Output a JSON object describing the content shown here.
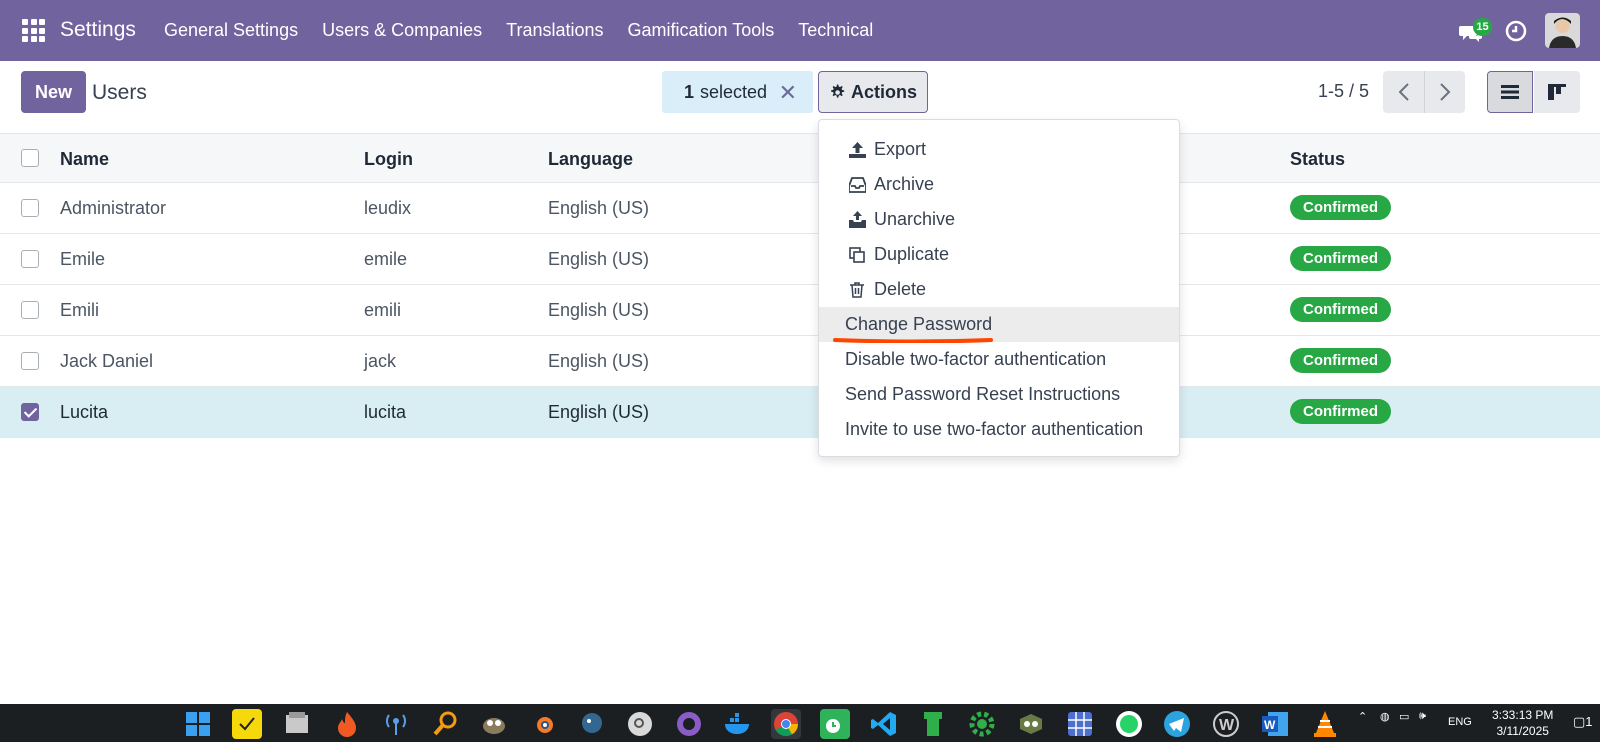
{
  "navbar": {
    "app_name": "Settings",
    "menu": [
      "General Settings",
      "Users & Companies",
      "Translations",
      "Gamification Tools",
      "Technical"
    ],
    "chat_count": "15",
    "bg_color": "#71639e"
  },
  "control_panel": {
    "new_label": "New",
    "breadcrumb": "Users",
    "selected_count": "1",
    "selected_label": "selected",
    "actions_label": "Actions",
    "pager": "1-5 / 5"
  },
  "table": {
    "headers": {
      "name": "Name",
      "login": "Login",
      "language": "Language",
      "status": "Status"
    },
    "rows": [
      {
        "name": "Administrator",
        "login": "leudix",
        "language": "English (US)",
        "status": "Confirmed",
        "selected": false
      },
      {
        "name": "Emile",
        "login": "emile",
        "language": "English (US)",
        "status": "Confirmed",
        "selected": false
      },
      {
        "name": "Emili",
        "login": "emili",
        "language": "English (US)",
        "status": "Confirmed",
        "selected": false
      },
      {
        "name": "Jack Daniel",
        "login": "jack",
        "language": "English (US)",
        "status": "Confirmed",
        "selected": false
      },
      {
        "name": "Lucita",
        "login": "lucita",
        "language": "English (US)",
        "status": "Confirmed",
        "selected": true
      }
    ]
  },
  "actions_menu": {
    "items": [
      {
        "label": "Export",
        "icon": "upload-icon"
      },
      {
        "label": "Archive",
        "icon": "inbox-icon"
      },
      {
        "label": "Unarchive",
        "icon": "unarchive-icon"
      },
      {
        "label": "Duplicate",
        "icon": "copy-icon"
      },
      {
        "label": "Delete",
        "icon": "trash-icon"
      },
      {
        "label": "Change Password",
        "icon": ""
      },
      {
        "label": "Disable two-factor authentication",
        "icon": ""
      },
      {
        "label": "Send Password Reset Instructions",
        "icon": ""
      },
      {
        "label": "Invite to use two-factor authentication",
        "icon": ""
      }
    ],
    "highlighted": "Change Password",
    "highlight_color": "#ff4500"
  },
  "taskbar": {
    "language": "ENG",
    "time": "3:33:13 PM",
    "date": "3/11/2025",
    "notifications": "1"
  }
}
